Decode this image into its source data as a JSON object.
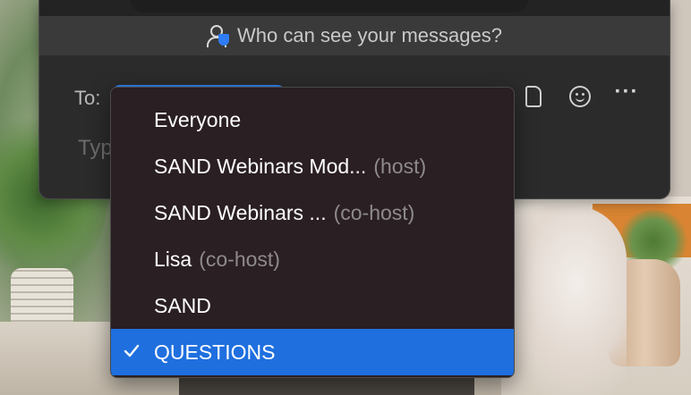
{
  "chat": {
    "visibility_label": "Who can see your messages?",
    "to_label": "To:",
    "input_placeholder": "Typ",
    "toolbar_icons": [
      "file-icon",
      "emoji-icon",
      "more-options-icon"
    ],
    "more_label": "···"
  },
  "recipient_menu": {
    "items": [
      {
        "name": "Everyone",
        "role": ""
      },
      {
        "name": "SAND Webinars Mod...",
        "role": "(host)"
      },
      {
        "name": "SAND Webinars ...",
        "role": "(co-host)"
      },
      {
        "name": "Lisa",
        "role": "(co-host)"
      },
      {
        "name": "SAND",
        "role": ""
      },
      {
        "name": "QUESTIONS",
        "role": ""
      }
    ],
    "selected_index": 5,
    "check_glyph": "✓"
  },
  "colors": {
    "accent": "#1f6fdf",
    "panel_bg": "#2b2b2b",
    "menu_bg": "#2a1f22",
    "role_text": "#8e8a8c"
  }
}
